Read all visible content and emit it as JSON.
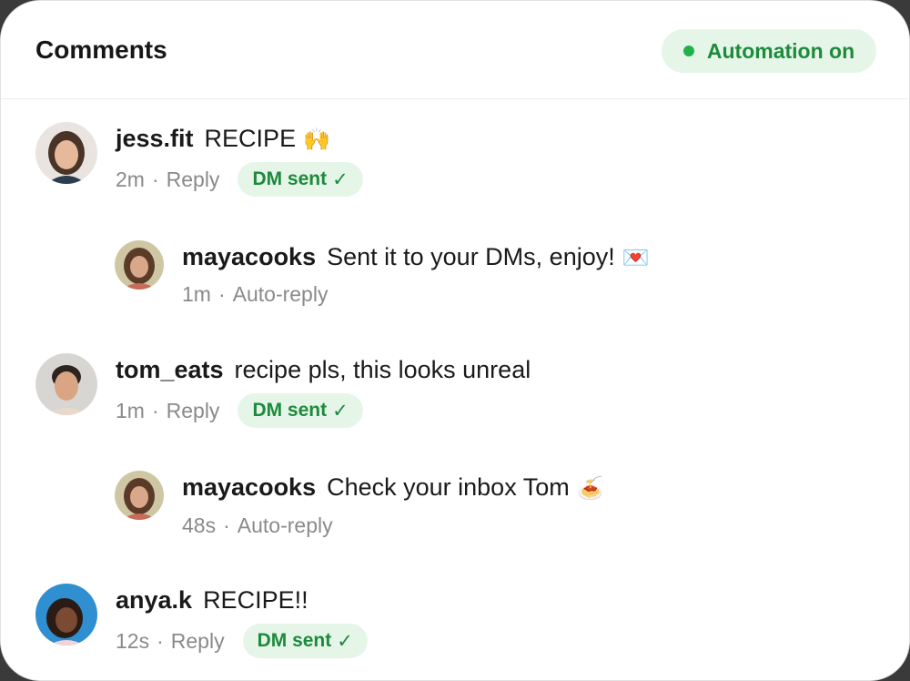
{
  "header": {
    "title": "Comments",
    "automation_label": "Automation on"
  },
  "comments": [
    {
      "username": "jess.fit",
      "text": "RECIPE",
      "emoji": "🙌",
      "time": "2m",
      "separator": "·",
      "action": "Reply",
      "status": "DM sent",
      "status_check": "✓"
    },
    {
      "username": "mayacooks",
      "text": "Sent it to your DMs, enjoy!",
      "emoji": "💌",
      "time": "1m",
      "separator": "·",
      "action": "Auto-reply"
    },
    {
      "username": "tom_eats",
      "text": "recipe pls, this looks unreal",
      "time": "1m",
      "separator": "·",
      "action": "Reply",
      "status": "DM sent",
      "status_check": "✓"
    },
    {
      "username": "mayacooks",
      "text": "Check your inbox Tom",
      "emoji": "🍝",
      "time": "48s",
      "separator": "·",
      "action": "Auto-reply"
    },
    {
      "username": "anya.k",
      "text": "RECIPE!!",
      "time": "12s",
      "separator": "·",
      "action": "Reply",
      "status": "DM sent",
      "status_check": "✓"
    }
  ],
  "colors": {
    "accent_green": "#1d8a3c",
    "pill_bg": "#e5f6e8",
    "status_dot": "#22b04b"
  }
}
